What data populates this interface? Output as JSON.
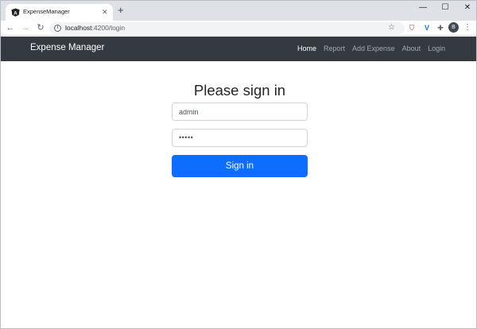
{
  "browser": {
    "tab": {
      "title": "ExpenseManager",
      "favicon": "angular-logo-icon"
    },
    "url": {
      "host": "localhost",
      "rest": ":4200/login"
    },
    "avatar_initial": "B"
  },
  "navbar": {
    "brand": "Expense Manager",
    "links": [
      {
        "label": "Home",
        "active": true
      },
      {
        "label": "Report",
        "active": false
      },
      {
        "label": "Add Expense",
        "active": false
      },
      {
        "label": "About",
        "active": false
      },
      {
        "label": "Login",
        "active": false
      }
    ]
  },
  "login": {
    "heading": "Please sign in",
    "username_value": "admin",
    "password_value": "•••••",
    "submit_label": "Sign in"
  },
  "colors": {
    "navbar_bg": "#343a40",
    "primary": "#0d6efd"
  }
}
